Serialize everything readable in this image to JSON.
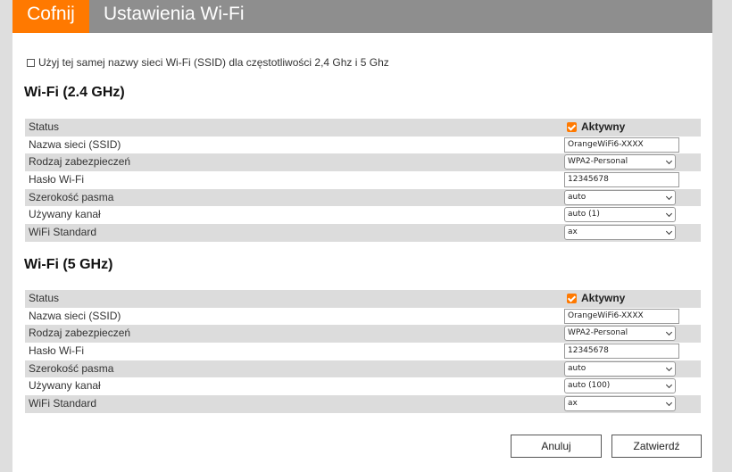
{
  "header": {
    "back_label": "Cofnij",
    "title": "Ustawienia Wi-Fi"
  },
  "same_ssid": {
    "label": "Użyj tej samej nazwy sieci Wi-Fi (SSID) dla częstotliwości 2,4 Ghz i 5 Ghz",
    "checked": false
  },
  "band24": {
    "title": "Wi-Fi (2.4 GHz)",
    "labels": {
      "status": "Status",
      "ssid": "Nazwa sieci (SSID)",
      "security": "Rodzaj zabezpieczeń",
      "password": "Hasło Wi-Fi",
      "bandwidth": "Szerokość pasma",
      "channel": "Używany kanał",
      "standard": "WiFi Standard"
    },
    "status_value": "Aktywny",
    "ssid": "OrangeWiFi6-XXXX",
    "security": "WPA2-Personal",
    "password": "12345678",
    "bandwidth": "auto",
    "channel": "auto (1)",
    "standard": "ax"
  },
  "band5": {
    "title": "Wi-Fi (5 GHz)",
    "labels": {
      "status": "Status",
      "ssid": "Nazwa sieci (SSID)",
      "security": "Rodzaj zabezpieczeń",
      "password": "Hasło Wi-Fi",
      "bandwidth": "Szerokość pasma",
      "channel": "Używany kanał",
      "standard": "WiFi Standard"
    },
    "status_value": "Aktywny",
    "ssid": "OrangeWiFi6-XXXX",
    "security": "WPA2-Personal",
    "password": "12345678",
    "bandwidth": "auto",
    "channel": "auto (100)",
    "standard": "ax"
  },
  "buttons": {
    "cancel": "Anuluj",
    "confirm": "Zatwierdź"
  },
  "colors": {
    "accent": "#ff7900",
    "header_bg": "#8e8e8e",
    "row_shade": "#dcdcdc"
  }
}
